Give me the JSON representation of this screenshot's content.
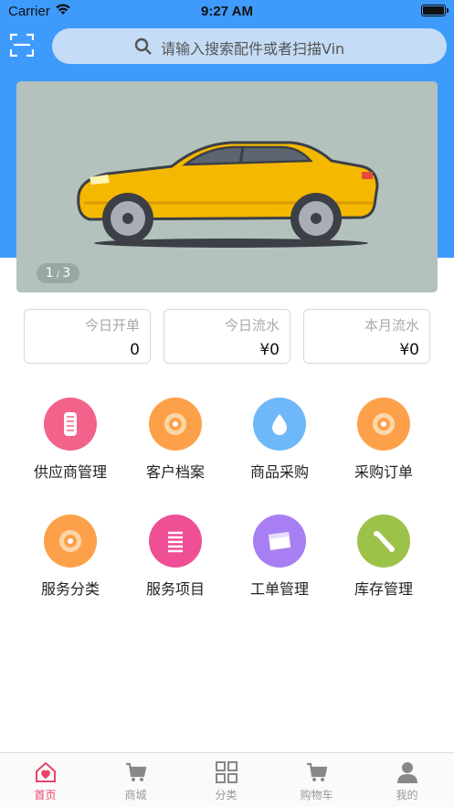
{
  "status_bar": {
    "carrier": "Carrier",
    "time": "9:27 AM"
  },
  "search": {
    "placeholder": "请输入搜索配件或者扫描Vin"
  },
  "banner": {
    "page_current": "1",
    "page_total": "3"
  },
  "stats": [
    {
      "label": "今日开单",
      "value": "0"
    },
    {
      "label": "今日流水",
      "value": "¥0"
    },
    {
      "label": "本月流水",
      "value": "¥0"
    }
  ],
  "menu": [
    {
      "label": "供应商管理",
      "color": "#f2628a",
      "icon": "supplier-icon"
    },
    {
      "label": "客户档案",
      "color": "#fca14a",
      "icon": "customer-file-icon"
    },
    {
      "label": "商品采购",
      "color": "#6eb8f9",
      "icon": "water-drop-icon"
    },
    {
      "label": "采购订单",
      "color": "#fca14a",
      "icon": "purchase-order-icon"
    },
    {
      "label": "服务分类",
      "color": "#fca14a",
      "icon": "service-category-icon"
    },
    {
      "label": "服务项目",
      "color": "#ee4f95",
      "icon": "spring-icon"
    },
    {
      "label": "工单管理",
      "color": "#a77ff2",
      "icon": "work-order-icon"
    },
    {
      "label": "库存管理",
      "color": "#9dc24a",
      "icon": "inventory-icon"
    }
  ],
  "tabbar": [
    {
      "label": "首页",
      "active": true
    },
    {
      "label": "商城",
      "active": false
    },
    {
      "label": "分类",
      "active": false
    },
    {
      "label": "购物车",
      "active": false
    },
    {
      "label": "我的",
      "active": false
    }
  ],
  "colors": {
    "header": "#3f9bfb",
    "active_tab": "#e8456a",
    "banner_bg": "#b3c2bd",
    "car_body": "#f5b800"
  }
}
